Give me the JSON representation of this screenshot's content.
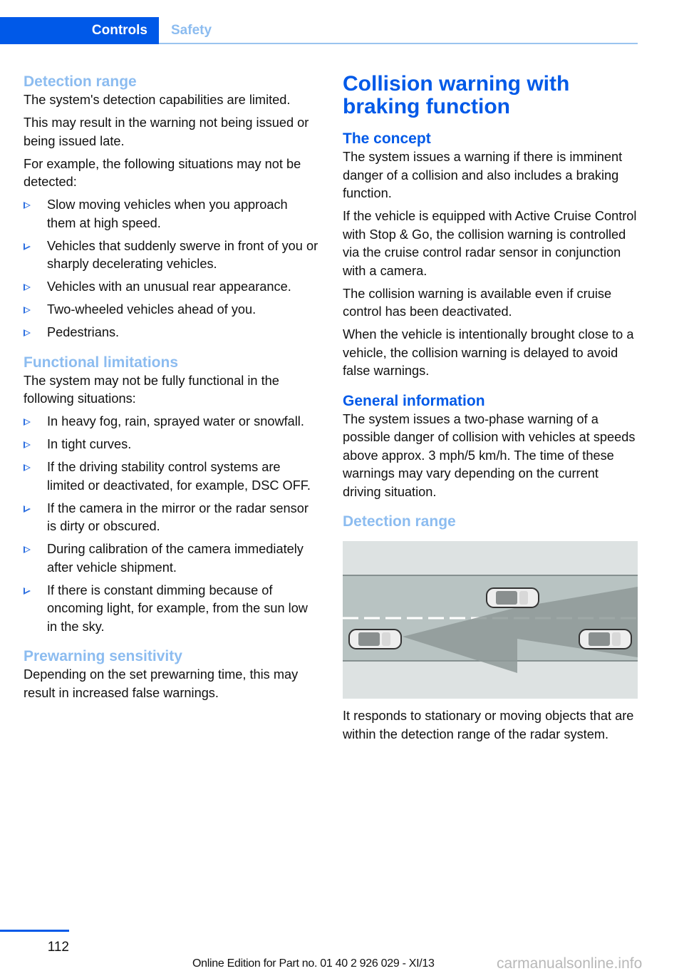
{
  "header": {
    "tabs": [
      {
        "label": "Controls",
        "active": true
      },
      {
        "label": "Safety",
        "active": false
      }
    ]
  },
  "left": {
    "detection": {
      "heading": "Detection range",
      "paragraphs": [
        "The system's detection capabilities are limited.",
        "This may result in the warning not being is­sued or being issued late.",
        "For example, the following situations may not be detected:"
      ],
      "bullets": [
        "Slow moving vehicles when you approach them at high speed.",
        "Vehicles that suddenly swerve in front of you or sharply decelerating vehicles.",
        "Vehicles with an unusual rear appearance.",
        "Two-wheeled vehicles ahead of you.",
        "Pedestrians."
      ]
    },
    "limitations": {
      "heading": "Functional limitations",
      "paragraphs": [
        "The system may not be fully functional in the following situations:"
      ],
      "bullets": [
        "In heavy fog, rain, sprayed water or snow­fall.",
        "In tight curves.",
        "If the driving stability control systems are limited or deactivated, for example, DSC OFF.",
        "If the camera in the mirror or the radar sen­sor is dirty or obscured.",
        "During calibration of the camera immedi­ately after vehicle shipment.",
        "If there is constant dimming because of oncoming light, for example, from the sun low in the sky."
      ]
    },
    "prewarning": {
      "heading": "Prewarning sensitivity",
      "paragraphs": [
        "Depending on the set prewarning time, this may result in increased false warnings."
      ]
    }
  },
  "right": {
    "title": "Collision warning with braking function",
    "concept": {
      "heading": "The concept",
      "paragraphs": [
        "The system issues a warning if there is immi­nent danger of a collision and also includes a braking function.",
        "If the vehicle is equipped with Active Cruise Control with Stop & Go, the collision warning is controlled via the cruise control radar sensor in conjunction with a camera.",
        "The collision warning is available even if cruise control has been deactivated.",
        "When the vehicle is intentionally brought close to a vehicle, the collision warning is delayed to avoid false warnings."
      ]
    },
    "general": {
      "heading": "General information",
      "paragraphs": [
        "The system issues a two-phase warning of a possible danger of collision with vehicles at speeds above approx. 3 mph/5 km/h. The time of these warnings may vary depending on the current driving situation."
      ]
    },
    "detection": {
      "heading": "Detection range",
      "figure_description": "Top view of a road with three cars and two grey radar detection cones",
      "paragraphs": [
        "It responds to stationary or moving objects that are within the detection range of the radar system."
      ]
    }
  },
  "footer": {
    "page_number": "112",
    "edition": "Online Edition for Part no. 01 40 2 926 029 - XI/13",
    "watermark": "carmanualsonline.info"
  },
  "colors": {
    "brand_blue": "#0059e8",
    "light_blue": "#8cbcf0",
    "text": "#111111"
  }
}
